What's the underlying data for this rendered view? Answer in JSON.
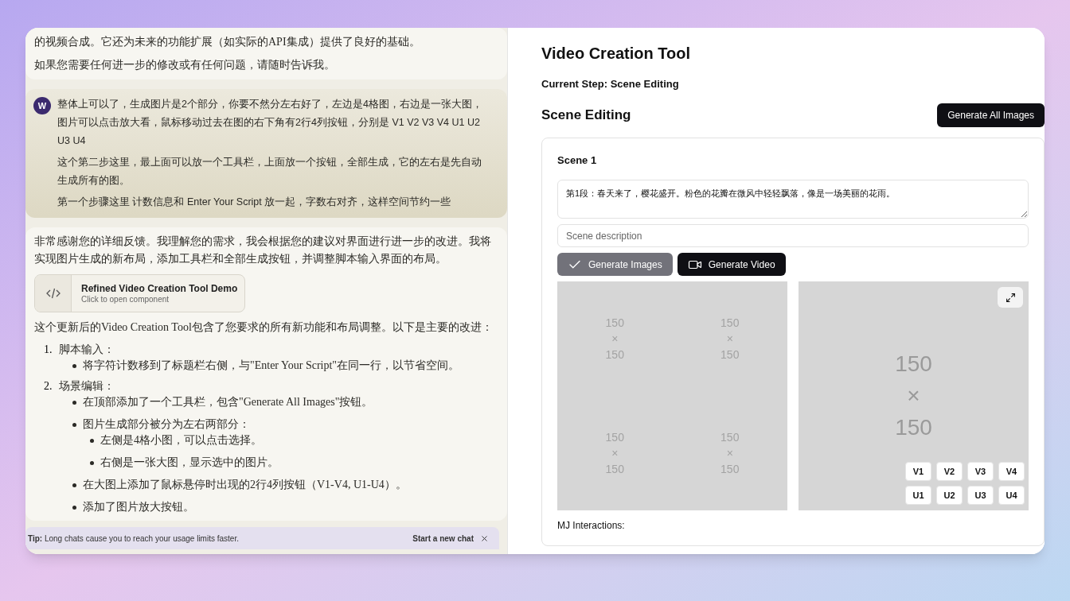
{
  "chat": {
    "messages": [
      {
        "kind": "assistant",
        "blocks": [
          {
            "kind": "paragraph",
            "text": "的视频合成。它还为未来的功能扩展（如实际的API集成）提供了良好的基础。"
          },
          {
            "kind": "paragraph",
            "text": "如果您需要任何进一步的修改或有任何问题，请随时告诉我。"
          }
        ]
      },
      {
        "kind": "user",
        "avatar": "W",
        "blocks": [
          {
            "kind": "paragraph",
            "text": "整体上可以了，生成图片是2个部分，你要不然分左右好了，左边是4格图，右边是一张大图，图片可以点击放大看，鼠标移动过去在图的右下角有2行4列按钮，分别是 V1 V2  V3 V4  U1  U2  U3  U4"
          },
          {
            "kind": "paragraph",
            "text": "这个第二步这里，最上面可以放一个工具栏，上面放一个按钮，全部生成，它的左右是先自动生成所有的图。"
          },
          {
            "kind": "paragraph",
            "text": "第一个步骤这里 计数信息和  Enter Your Script 放一起，字数右对齐，这样空间节约一些"
          }
        ]
      },
      {
        "kind": "assistant",
        "blocks": [
          {
            "kind": "paragraph",
            "text": "非常感谢您的详细反馈。我理解您的需求，我会根据您的建议对界面进行进一步的改进。我将实现图片生成的新布局，添加工具栏和全部生成按钮，并调整脚本输入界面的布局。"
          },
          {
            "kind": "artifact",
            "title": "Refined Video Creation Tool Demo",
            "subtitle": "Click to open component"
          },
          {
            "kind": "paragraph",
            "text": "这个更新后的Video Creation Tool包含了您要求的所有新功能和布局调整。以下是主要的改进："
          },
          {
            "kind": "list",
            "items": [
              {
                "number": "1.",
                "text": "脚本输入：",
                "children": [
                  {
                    "text": "将字符计数移到了标题栏右侧，与\"Enter Your Script\"在同一行，以节省空间。"
                  }
                ]
              },
              {
                "number": "2.",
                "text": "场景编辑：",
                "children": [
                  {
                    "text": "在顶部添加了一个工具栏，包含\"Generate All Images\"按钮。"
                  },
                  {
                    "text": "图片生成部分被分为左右两部分：",
                    "children": [
                      {
                        "text": "左侧是4格小图，可以点击选择。"
                      },
                      {
                        "text": "右侧是一张大图，显示选中的图片。"
                      }
                    ]
                  },
                  {
                    "text": "在大图上添加了鼠标悬停时出现的2行4列按钮（V1-V4, U1-U4）。"
                  },
                  {
                    "text": "添加了图片放大按钮。"
                  }
                ]
              }
            ]
          }
        ]
      }
    ],
    "tip": {
      "label": "Tip:",
      "text": "Long chats cause you to reach your usage limits faster.",
      "action": "Start a new chat"
    }
  },
  "tool": {
    "title": "Video Creation Tool",
    "current_step": "Current Step: Scene Editing",
    "section_title": "Scene Editing",
    "generate_all_button": "Generate All Images",
    "scene": {
      "title": "Scene 1",
      "script": "第1段：春天来了，樱花盛开。粉色的花瓣在微风中轻轻飘落，像是一场美丽的花雨。",
      "description_placeholder": "Scene description",
      "buttons": [
        {
          "kind": "images",
          "label": "Generate Images",
          "disabled": true
        },
        {
          "kind": "video",
          "label": "Generate Video",
          "disabled": false
        }
      ],
      "thumbnails": [
        [
          "150",
          "×",
          "150"
        ],
        [
          "150",
          "×",
          "150"
        ],
        [
          "150",
          "×",
          "150"
        ],
        [
          "150",
          "×",
          "150"
        ]
      ],
      "large_image": [
        "150",
        "×",
        "150"
      ],
      "variation_buttons": [
        "V1",
        "V2",
        "V3",
        "V4",
        "U1",
        "U2",
        "U3",
        "U4"
      ],
      "mj_label": "MJ Interactions:"
    }
  }
}
